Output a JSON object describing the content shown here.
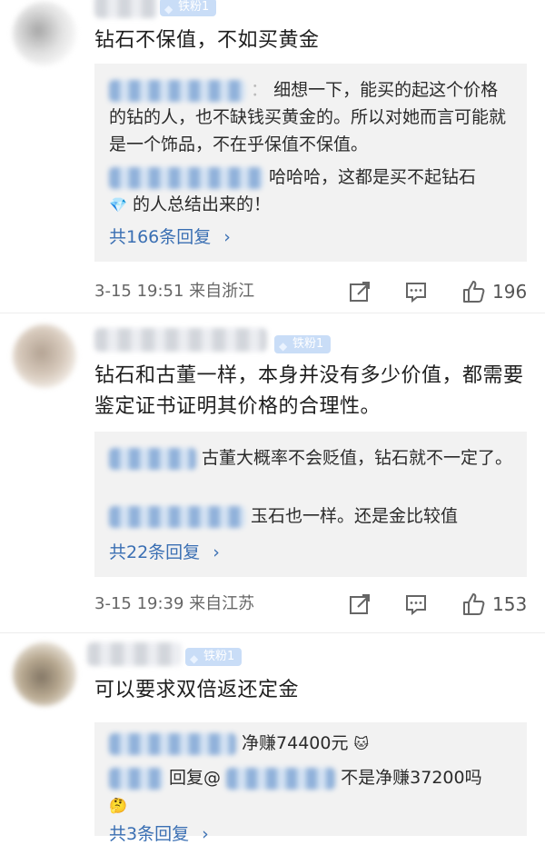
{
  "comments": [
    {
      "badge": "铁粉1",
      "text": "钻石不保值，不如买黄金",
      "replies": [
        {
          "prefix": "：",
          "text": "细想一下，能买的起这个价格的钻的人，也不缺钱买黄金的。所以对她而言可能就是一个饰品，不在乎保值不保值。"
        },
        {
          "text": "哈哈哈，这都是买不起钻石",
          "emoji": "💎",
          "text2": "的人总结出来的！"
        }
      ],
      "more": "共166条回复",
      "time": "3-15 19:51 来自浙江",
      "likes": "196"
    },
    {
      "badge": "铁粉1",
      "text": "钻石和古董一样，本身并没有多少价值，都需要鉴定证书证明其价格的合理性。",
      "replies": [
        {
          "text": "古董大概率不会贬值，钻石就不一定了。"
        },
        {
          "text": "玉石也一样。还是金比较值"
        }
      ],
      "more": "共22条回复",
      "time": "3-15 19:39 来自江苏",
      "likes": "153"
    },
    {
      "badge": "铁粉1",
      "text": "可以要求双倍返还定金",
      "replies": [
        {
          "text": "净赚74400元",
          "emoji": "🐱"
        },
        {
          "prefix": "回复@",
          "text": "不是净赚37200吗",
          "emoji": "🤔"
        }
      ],
      "more": "共3条回复"
    }
  ],
  "icons": {
    "share": "share-icon",
    "comment": "comment-icon",
    "like": "thumbs-up-icon",
    "chevron": "chevron-right-icon",
    "badge_gem": "diamond-icon"
  },
  "colors": {
    "link": "#3a6fb3",
    "badge": "#c9ddf7",
    "reply_bg": "#f2f2f2"
  }
}
